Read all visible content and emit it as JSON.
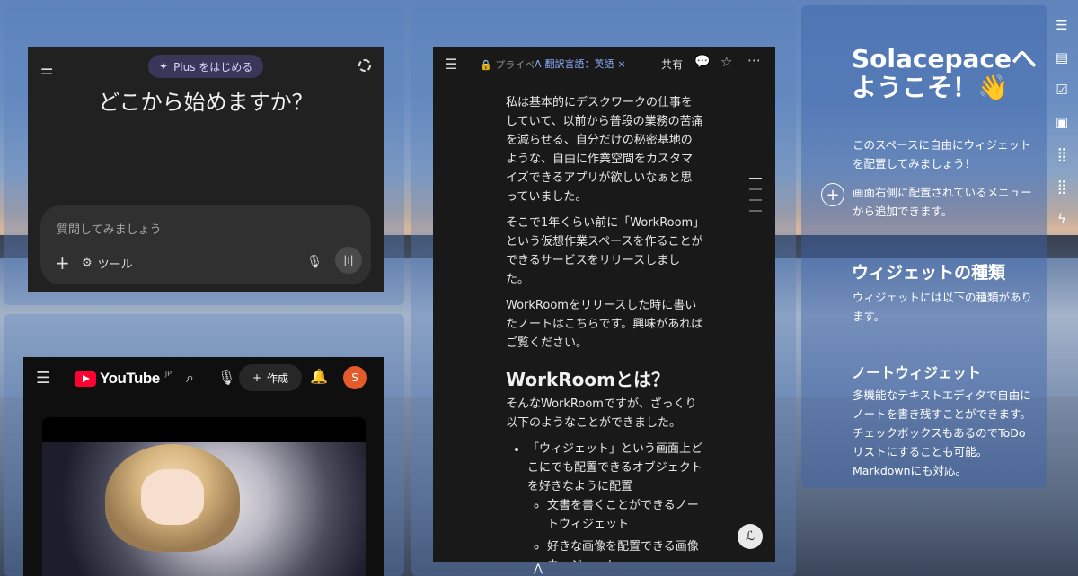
{
  "chat": {
    "plus_label": "Plus をはじめる",
    "heading": "どこから始めますか？",
    "placeholder": "質問してみましょう",
    "tools_label": "ツール"
  },
  "youtube": {
    "logo": "YouTube",
    "region": "JP",
    "create_label": "作成",
    "avatar_initial": "S"
  },
  "note": {
    "private_label": "プライベ",
    "translate_label": "翻訳言語：英語",
    "share_label": "共有",
    "paragraphs": [
      "私は基本的にデスクワークの仕事をしていて、以前から普段の業務の苦痛を減らせる、自分だけの秘密基地のような、自由に作業空間をカスタマイズできるアプリが欲しいなぁと思っていました。",
      "そこで1年くらい前に「WorkRoom」という仮想作業スペースを作ることができるサービスをリリースしました。",
      "WorkRoomをリリースした時に書いたノートはこちらです。興味があればご覧ください。"
    ],
    "heading": "WorkRoomとは？",
    "intro": "そんなWorkRoomですが、ざっくり以下のようなことができました。",
    "bullet": "「ウィジェット」という画面上どこにでも配置できるオブジェクトを好きなように配置",
    "sub_bullets": [
      "文書を書くことができるノートウィジェット",
      "好きな画像を配置できる画像ウィジェット"
    ]
  },
  "info": {
    "title_line1": "Solacepaceへ",
    "title_line2": "ようこそ！👋",
    "p1": "このスペースに自由にウィジェットを配置してみましょう！",
    "p2": "画面右側に配置されているメニューから追加できます。",
    "h_types": "ウィジェットの種類",
    "p3": "ウィジェットには以下の種類があります。",
    "h_note": "ノートウィジェット",
    "p4": "多機能なテキストエディタで自由にノートを書き残すことができます。チェックボックスもあるのでToDoリストにすることも可能。Markdownにも対応。"
  },
  "rail_icons": [
    "menu-icon",
    "page-icon",
    "calendar-check-icon",
    "image-icon",
    "grid-icon",
    "grid-icon",
    "bolt-icon"
  ]
}
